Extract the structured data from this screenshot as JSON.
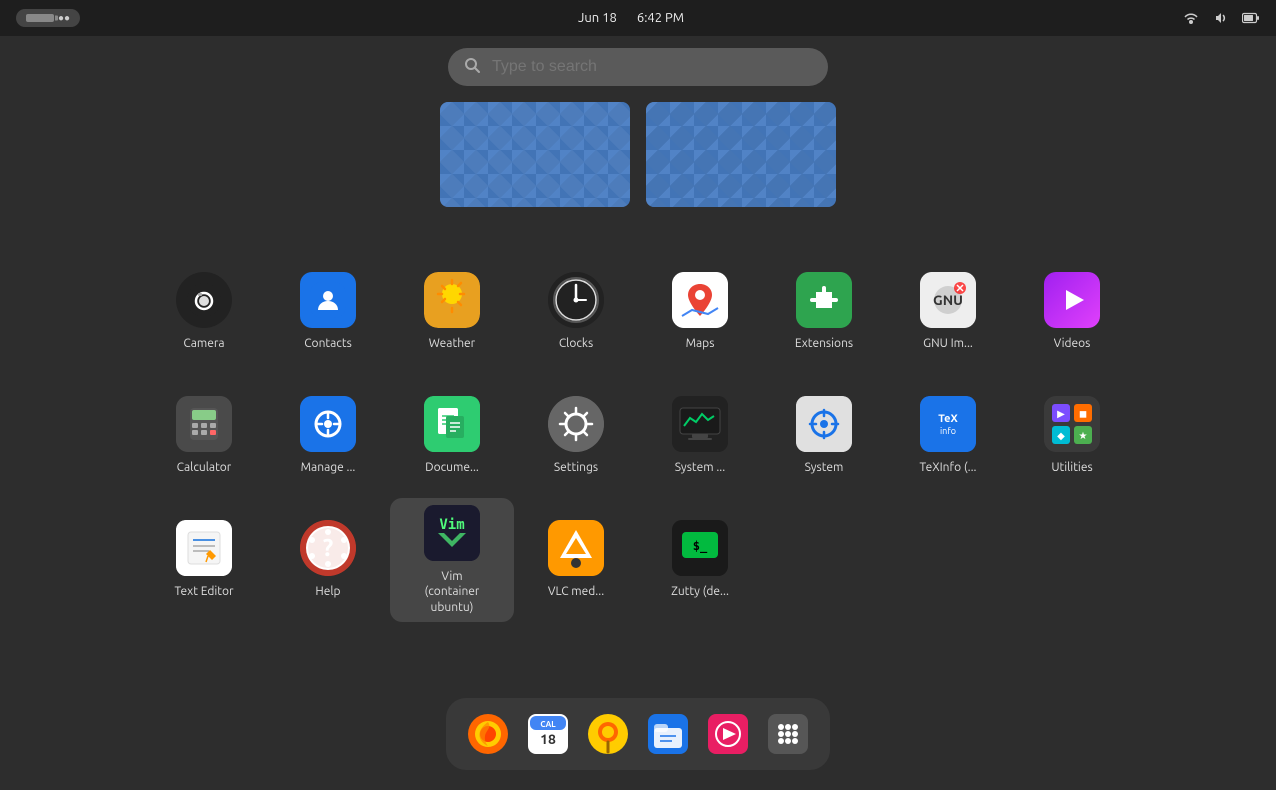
{
  "topbar": {
    "date": "Jun 18",
    "time": "6:42 PM",
    "battery_label": "●●●",
    "icons": [
      "network-icon",
      "volume-icon",
      "battery-icon"
    ]
  },
  "search": {
    "placeholder": "Type to search"
  },
  "workspaces": [
    {
      "id": 1
    },
    {
      "id": 2
    }
  ],
  "apps": [
    [
      {
        "id": "camera",
        "label": "Camera",
        "icon": "camera"
      },
      {
        "id": "contacts",
        "label": "Contacts",
        "icon": "contacts"
      },
      {
        "id": "weather",
        "label": "Weather",
        "icon": "weather"
      },
      {
        "id": "clocks",
        "label": "Clocks",
        "icon": "clocks"
      },
      {
        "id": "maps",
        "label": "Maps",
        "icon": "maps"
      },
      {
        "id": "extensions",
        "label": "Extensions",
        "icon": "extensions"
      },
      {
        "id": "gnu",
        "label": "GNU Im...",
        "icon": "gnu"
      },
      {
        "id": "videos",
        "label": "Videos",
        "icon": "videos"
      }
    ],
    [
      {
        "id": "calculator",
        "label": "Calculator",
        "icon": "calculator"
      },
      {
        "id": "manager",
        "label": "Manage ...",
        "icon": "manager"
      },
      {
        "id": "documents",
        "label": "Docume...",
        "icon": "documents"
      },
      {
        "id": "settings",
        "label": "Settings",
        "icon": "settings"
      },
      {
        "id": "sysmon",
        "label": "System ...",
        "icon": "sysmon"
      },
      {
        "id": "system",
        "label": "System",
        "icon": "system"
      },
      {
        "id": "texinfo",
        "label": "TeXInfo (...",
        "icon": "texinfo"
      },
      {
        "id": "utilities",
        "label": "Utilities",
        "icon": "utilities"
      }
    ],
    [
      {
        "id": "texteditor",
        "label": "Text Editor",
        "icon": "texteditor"
      },
      {
        "id": "help",
        "label": "Help",
        "icon": "help"
      },
      {
        "id": "vim",
        "label": "Vim\n(container\nubuntu)",
        "icon": "vim",
        "selected": true
      },
      {
        "id": "vlc",
        "label": "VLC med...",
        "icon": "vlc"
      },
      {
        "id": "zutty",
        "label": "Zutty (de...",
        "icon": "zutty"
      }
    ]
  ],
  "dock": [
    {
      "id": "firefox",
      "label": "Firefox"
    },
    {
      "id": "calendar",
      "label": "Calendar"
    },
    {
      "id": "lollypop",
      "label": "Lollypop"
    },
    {
      "id": "files",
      "label": "Files"
    },
    {
      "id": "software",
      "label": "Software"
    },
    {
      "id": "appgrid",
      "label": "All Apps"
    }
  ]
}
